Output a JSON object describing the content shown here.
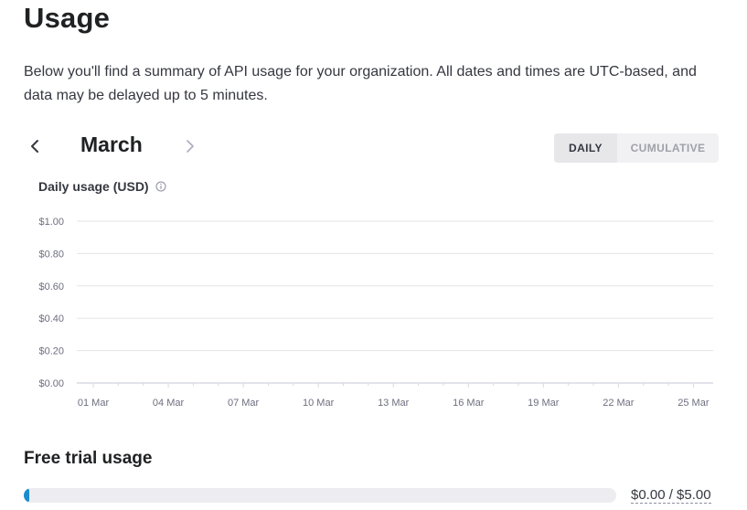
{
  "page": {
    "title": "Usage",
    "description": "Below you'll find a summary of API usage for your organization. All dates and times are UTC-based, and data may be delayed up to 5 minutes."
  },
  "month_nav": {
    "month": "March",
    "prev_icon": "chevron-left-icon",
    "next_icon": "chevron-right-icon"
  },
  "view_toggle": {
    "daily_label": "DAILY",
    "cumulative_label": "CUMULATIVE",
    "selected": "DAILY"
  },
  "chart_data": {
    "type": "bar",
    "title": "Daily usage (USD)",
    "categories": [
      "01 Mar",
      "02 Mar",
      "03 Mar",
      "04 Mar",
      "05 Mar",
      "06 Mar",
      "07 Mar",
      "08 Mar",
      "09 Mar",
      "10 Mar",
      "11 Mar",
      "12 Mar",
      "13 Mar",
      "14 Mar",
      "15 Mar",
      "16 Mar",
      "17 Mar",
      "18 Mar",
      "19 Mar",
      "20 Mar",
      "21 Mar",
      "22 Mar",
      "23 Mar",
      "24 Mar",
      "25 Mar"
    ],
    "x_tick_labels": [
      "01 Mar",
      "04 Mar",
      "07 Mar",
      "10 Mar",
      "13 Mar",
      "16 Mar",
      "19 Mar",
      "22 Mar",
      "25 Mar"
    ],
    "values": [
      0,
      0,
      0,
      0,
      0,
      0,
      0,
      0,
      0,
      0,
      0,
      0,
      0,
      0,
      0,
      0,
      0,
      0,
      0,
      0,
      0,
      0,
      0,
      0,
      0
    ],
    "y_ticks": [
      0,
      0.2,
      0.4,
      0.6,
      0.8,
      1.0
    ],
    "y_tick_labels": [
      "$0.00",
      "$0.20",
      "$0.40",
      "$0.60",
      "$0.80",
      "$1.00"
    ],
    "ylim": [
      0,
      1.0
    ],
    "grid": true,
    "info_icon": "info-circle-icon"
  },
  "free_trial": {
    "title": "Free trial usage",
    "used": 0,
    "limit": 5,
    "amount_text": "$0.00 / $5.00",
    "fraction": 0
  },
  "colors": {
    "accent": "#10a37f",
    "progress_marker": "#1a8ccf",
    "grid": "#e5e5e5"
  }
}
